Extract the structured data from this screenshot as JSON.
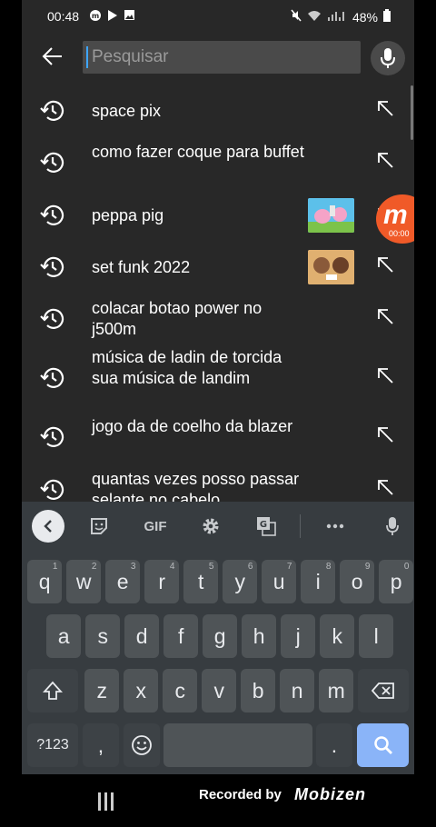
{
  "status_bar": {
    "time": "00:48",
    "battery": "48%",
    "left_icons": [
      "mobizen-icon",
      "play-store-icon",
      "image-icon"
    ],
    "right_icons": [
      "mute-icon",
      "wifi-icon",
      "signal-icon",
      "battery-icon"
    ]
  },
  "search": {
    "placeholder": "Pesquisar"
  },
  "suggestions": [
    {
      "text": "space pix",
      "has_thumbnail": false
    },
    {
      "text": "como fazer coque para buffet",
      "has_thumbnail": false
    },
    {
      "text": "peppa pig",
      "has_thumbnail": true
    },
    {
      "text": "set funk 2022",
      "has_thumbnail": true
    },
    {
      "text": "colacar botao power no j500m",
      "has_thumbnail": false
    },
    {
      "text": "música de ladin de torcida sua música de landim",
      "has_thumbnail": false
    },
    {
      "text": "jogo da de coelho da blazer",
      "has_thumbnail": false
    },
    {
      "text": "quantas vezes posso passar selante no cabelo",
      "has_thumbnail": false
    }
  ],
  "recorder": {
    "time": "00:00"
  },
  "keyboard": {
    "toolbar": {
      "gif_label": "GIF"
    },
    "rows": [
      [
        {
          "k": "q",
          "h": "1"
        },
        {
          "k": "w",
          "h": "2"
        },
        {
          "k": "e",
          "h": "3"
        },
        {
          "k": "r",
          "h": "4"
        },
        {
          "k": "t",
          "h": "5"
        },
        {
          "k": "y",
          "h": "6"
        },
        {
          "k": "u",
          "h": "7"
        },
        {
          "k": "i",
          "h": "8"
        },
        {
          "k": "o",
          "h": "9"
        },
        {
          "k": "p",
          "h": "0"
        }
      ],
      [
        {
          "k": "a"
        },
        {
          "k": "s"
        },
        {
          "k": "d"
        },
        {
          "k": "f"
        },
        {
          "k": "g"
        },
        {
          "k": "h"
        },
        {
          "k": "j"
        },
        {
          "k": "k"
        },
        {
          "k": "l"
        }
      ],
      [
        {
          "k": "z"
        },
        {
          "k": "x"
        },
        {
          "k": "c"
        },
        {
          "k": "v"
        },
        {
          "k": "b"
        },
        {
          "k": "n"
        },
        {
          "k": "m"
        }
      ]
    ],
    "symbols_label": "?123",
    "comma_label": ",",
    "period_label": "."
  },
  "watermark": {
    "recorded_by": "Recorded by",
    "brand": "Mobizen"
  },
  "colors": {
    "background": "#282828",
    "keyboard": "#373c40",
    "search_key": "#8ab4f8",
    "mobizen": "#f05a28"
  }
}
